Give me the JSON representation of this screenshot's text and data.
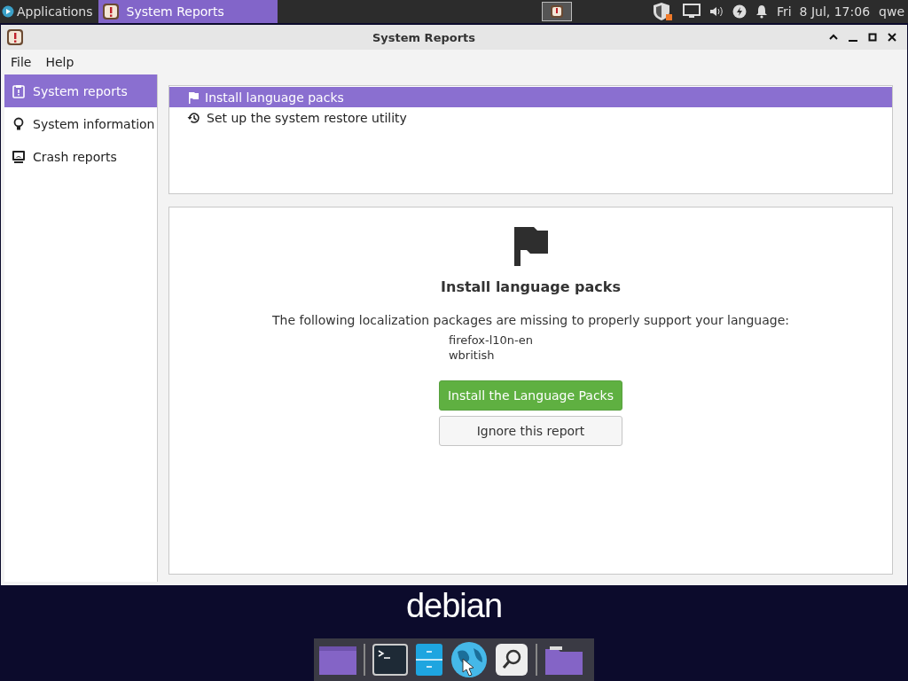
{
  "top_panel": {
    "applications": "Applications",
    "tasks": [
      {
        "title": "System Reports",
        "selected": true
      }
    ],
    "clock": "Fri  8 Jul, 17:06",
    "user": "qwe"
  },
  "window": {
    "title": "System Reports"
  },
  "menu": [
    "File",
    "Help"
  ],
  "sidebar": {
    "items": [
      {
        "label": "System reports",
        "kind": "reports",
        "selected": true
      },
      {
        "label": "System information",
        "kind": "info",
        "selected": false
      },
      {
        "label": "Crash reports",
        "kind": "crash",
        "selected": false
      }
    ]
  },
  "reports": [
    {
      "label": "Install language packs",
      "kind": "flag",
      "selected": true
    },
    {
      "label": "Set up the system restore utility",
      "kind": "history",
      "selected": false
    }
  ],
  "detail": {
    "title": "Install language packs",
    "message": "The following localization packages are missing to properly support your language:",
    "packages": [
      "firefox-l10n-en",
      "wbritish"
    ],
    "primary_button": "Install the Language Packs",
    "secondary_button": "Ignore this report"
  },
  "desktop": {
    "logo": "debian"
  }
}
